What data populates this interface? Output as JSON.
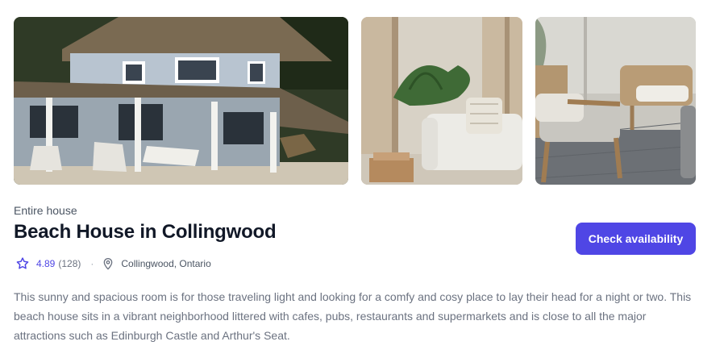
{
  "listing": {
    "type": "Entire house",
    "title": "Beach House in Collingwood",
    "rating": "4.89",
    "review_count": "(128)",
    "separator": "·",
    "location": "Collingwood, Ontario",
    "description": "This sunny and spacious room is for those traveling light and looking for a comfy and cosy place to lay their head for a night or two. This beach house sits in a vibrant neighborhood littered with cafes, pubs, restaurants and supermarkets and is close to all the major attractions such as Edinburgh Castle and Arthur's Seat."
  },
  "actions": {
    "check_availability": "Check availability"
  },
  "icons": {
    "rating": "star-icon",
    "location": "map-pin-icon"
  },
  "colors": {
    "accent": "#4f46e5",
    "text_primary": "#111827",
    "text_muted": "#6b7280"
  }
}
